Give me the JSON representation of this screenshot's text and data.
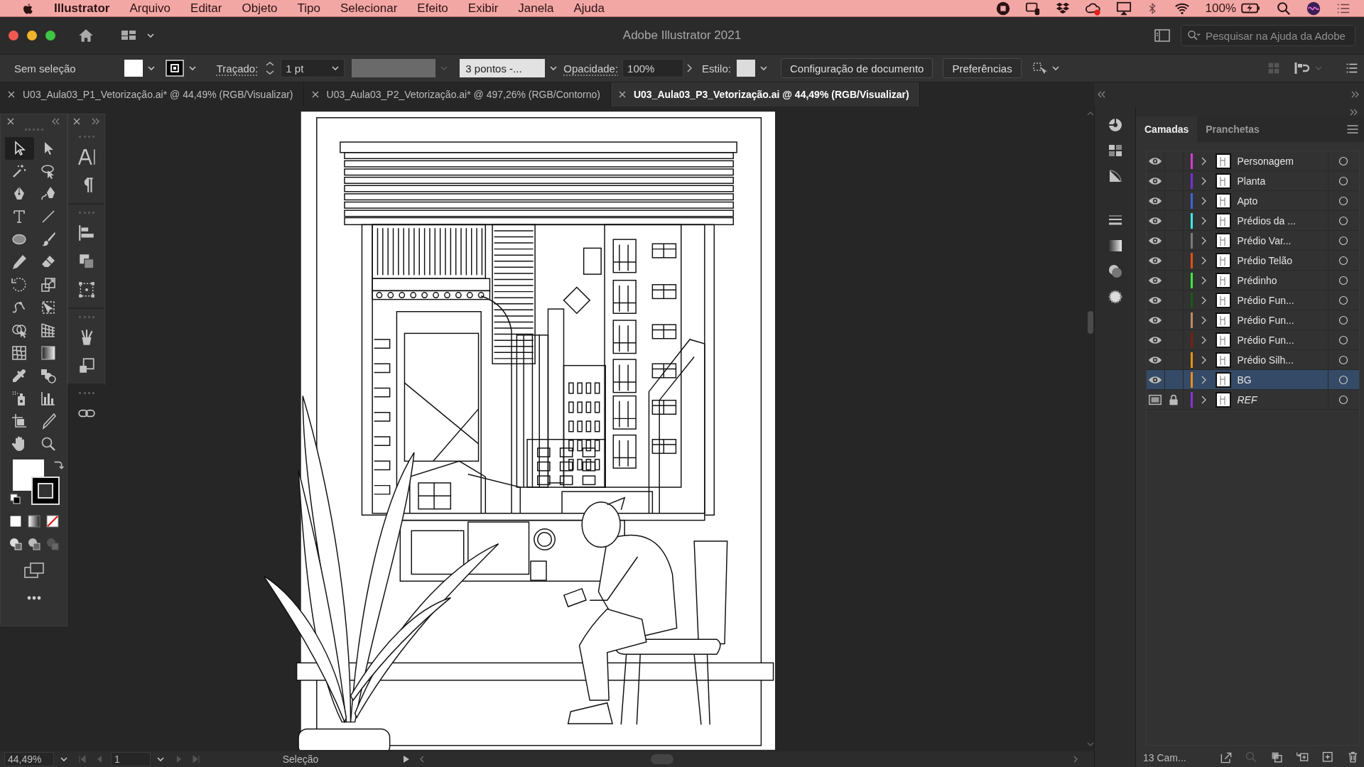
{
  "menubar": {
    "app": "Illustrator",
    "items": [
      "Arquivo",
      "Editar",
      "Objeto",
      "Tipo",
      "Selecionar",
      "Efeito",
      "Exibir",
      "Janela",
      "Ajuda"
    ],
    "battery": "100%"
  },
  "window": {
    "title": "Adobe Illustrator 2021",
    "search": {
      "placeholder": "Pesquisar na Ajuda da Adobe"
    }
  },
  "control_bar": {
    "selection": "Sem seleção",
    "stroke_label": "Traçado:",
    "stroke_weight": "1 pt",
    "brush": "3 pontos -...",
    "opacity_label": "Opacidade:",
    "opacity": "100%",
    "style_label": "Estilo:",
    "buttons": [
      "Configuração de documento",
      "Preferências"
    ]
  },
  "tabs": [
    {
      "label": "U03_Aula03_P1_Vetorização.ai* @ 44,49% (RGB/Visualizar)",
      "selected": false
    },
    {
      "label": "U03_Aula03_P2_Vetorização.ai* @ 497,26% (RGB/Contorno)",
      "selected": false
    },
    {
      "label": "U03_Aula03_P3_Vetorização.ai @ 44,49% (RGB/Visualizar)",
      "selected": true
    }
  ],
  "tools": [
    {
      "kind": "selection",
      "selected": true
    },
    {
      "kind": "direct",
      "selected": false
    },
    {
      "kind": "wand",
      "selected": false
    },
    {
      "kind": "lasso",
      "selected": false
    },
    {
      "kind": "pen",
      "selected": false
    },
    {
      "kind": "curvature",
      "selected": false
    },
    {
      "kind": "type",
      "selected": false
    },
    {
      "kind": "line",
      "selected": false
    },
    {
      "kind": "ellipse",
      "selected": false
    },
    {
      "kind": "brush",
      "selected": false
    },
    {
      "kind": "pencil",
      "selected": false
    },
    {
      "kind": "eraser",
      "selected": false
    },
    {
      "kind": "rotate",
      "selected": false
    },
    {
      "kind": "scale",
      "selected": false
    },
    {
      "kind": "warp",
      "selected": false
    },
    {
      "kind": "transform",
      "selected": false
    },
    {
      "kind": "builder",
      "selected": false
    },
    {
      "kind": "perspective",
      "selected": false
    },
    {
      "kind": "mesh",
      "selected": false
    },
    {
      "kind": "gradient",
      "selected": false
    },
    {
      "kind": "eyedropper",
      "selected": false
    },
    {
      "kind": "blend",
      "selected": false
    },
    {
      "kind": "spray",
      "selected": false
    },
    {
      "kind": "graph",
      "selected": false
    },
    {
      "kind": "artboard",
      "selected": false
    },
    {
      "kind": "knife",
      "selected": false
    },
    {
      "kind": "hand",
      "selected": false
    },
    {
      "kind": "zoom",
      "selected": false
    }
  ],
  "layers_panel": {
    "tabs": [
      {
        "label": "Camadas",
        "selected": true
      },
      {
        "label": "Pranchetas",
        "selected": false
      }
    ],
    "layers": [
      {
        "name": "Personagem",
        "color": "#d63ad6",
        "kind": "layer",
        "visible": true,
        "locked": false,
        "selected": false
      },
      {
        "name": "Planta",
        "color": "#7a2fd6",
        "kind": "layer",
        "visible": true,
        "locked": false,
        "selected": false
      },
      {
        "name": "Apto",
        "color": "#3f63d8",
        "kind": "layer",
        "visible": true,
        "locked": false,
        "selected": false
      },
      {
        "name": "Prédios da ...",
        "color": "#3ee8e8",
        "kind": "layer",
        "visible": true,
        "locked": false,
        "selected": false
      },
      {
        "name": "Prédio Var...",
        "color": "#7a7a7a",
        "kind": "layer",
        "visible": true,
        "locked": false,
        "selected": false
      },
      {
        "name": "Prédio Telão",
        "color": "#e0501a",
        "kind": "layer",
        "visible": true,
        "locked": false,
        "selected": false
      },
      {
        "name": "Prédinho",
        "color": "#3ee83e",
        "kind": "layer",
        "visible": true,
        "locked": false,
        "selected": false
      },
      {
        "name": "Prédio Fun...",
        "color": "#1a5a1a",
        "kind": "layer",
        "visible": true,
        "locked": false,
        "selected": false
      },
      {
        "name": "Prédio Fun...",
        "color": "#c08860",
        "kind": "layer",
        "visible": true,
        "locked": false,
        "selected": false
      },
      {
        "name": "Prédio Fun...",
        "color": "#7a2010",
        "kind": "layer",
        "visible": true,
        "locked": false,
        "selected": false
      },
      {
        "name": "Prédio Silh...",
        "color": "#e8901a",
        "kind": "layer",
        "visible": true,
        "locked": false,
        "selected": false
      },
      {
        "name": "BG",
        "color": "#e8901a",
        "kind": "layer",
        "visible": true,
        "locked": false,
        "selected": true
      },
      {
        "name": "REF",
        "color": "#8a2fd6",
        "kind": "template",
        "visible": true,
        "locked": true,
        "selected": false
      }
    ],
    "footer": "13 Cam..."
  },
  "status_bar": {
    "zoom": "44,49%",
    "artboard": "1",
    "tool": "Seleção"
  }
}
